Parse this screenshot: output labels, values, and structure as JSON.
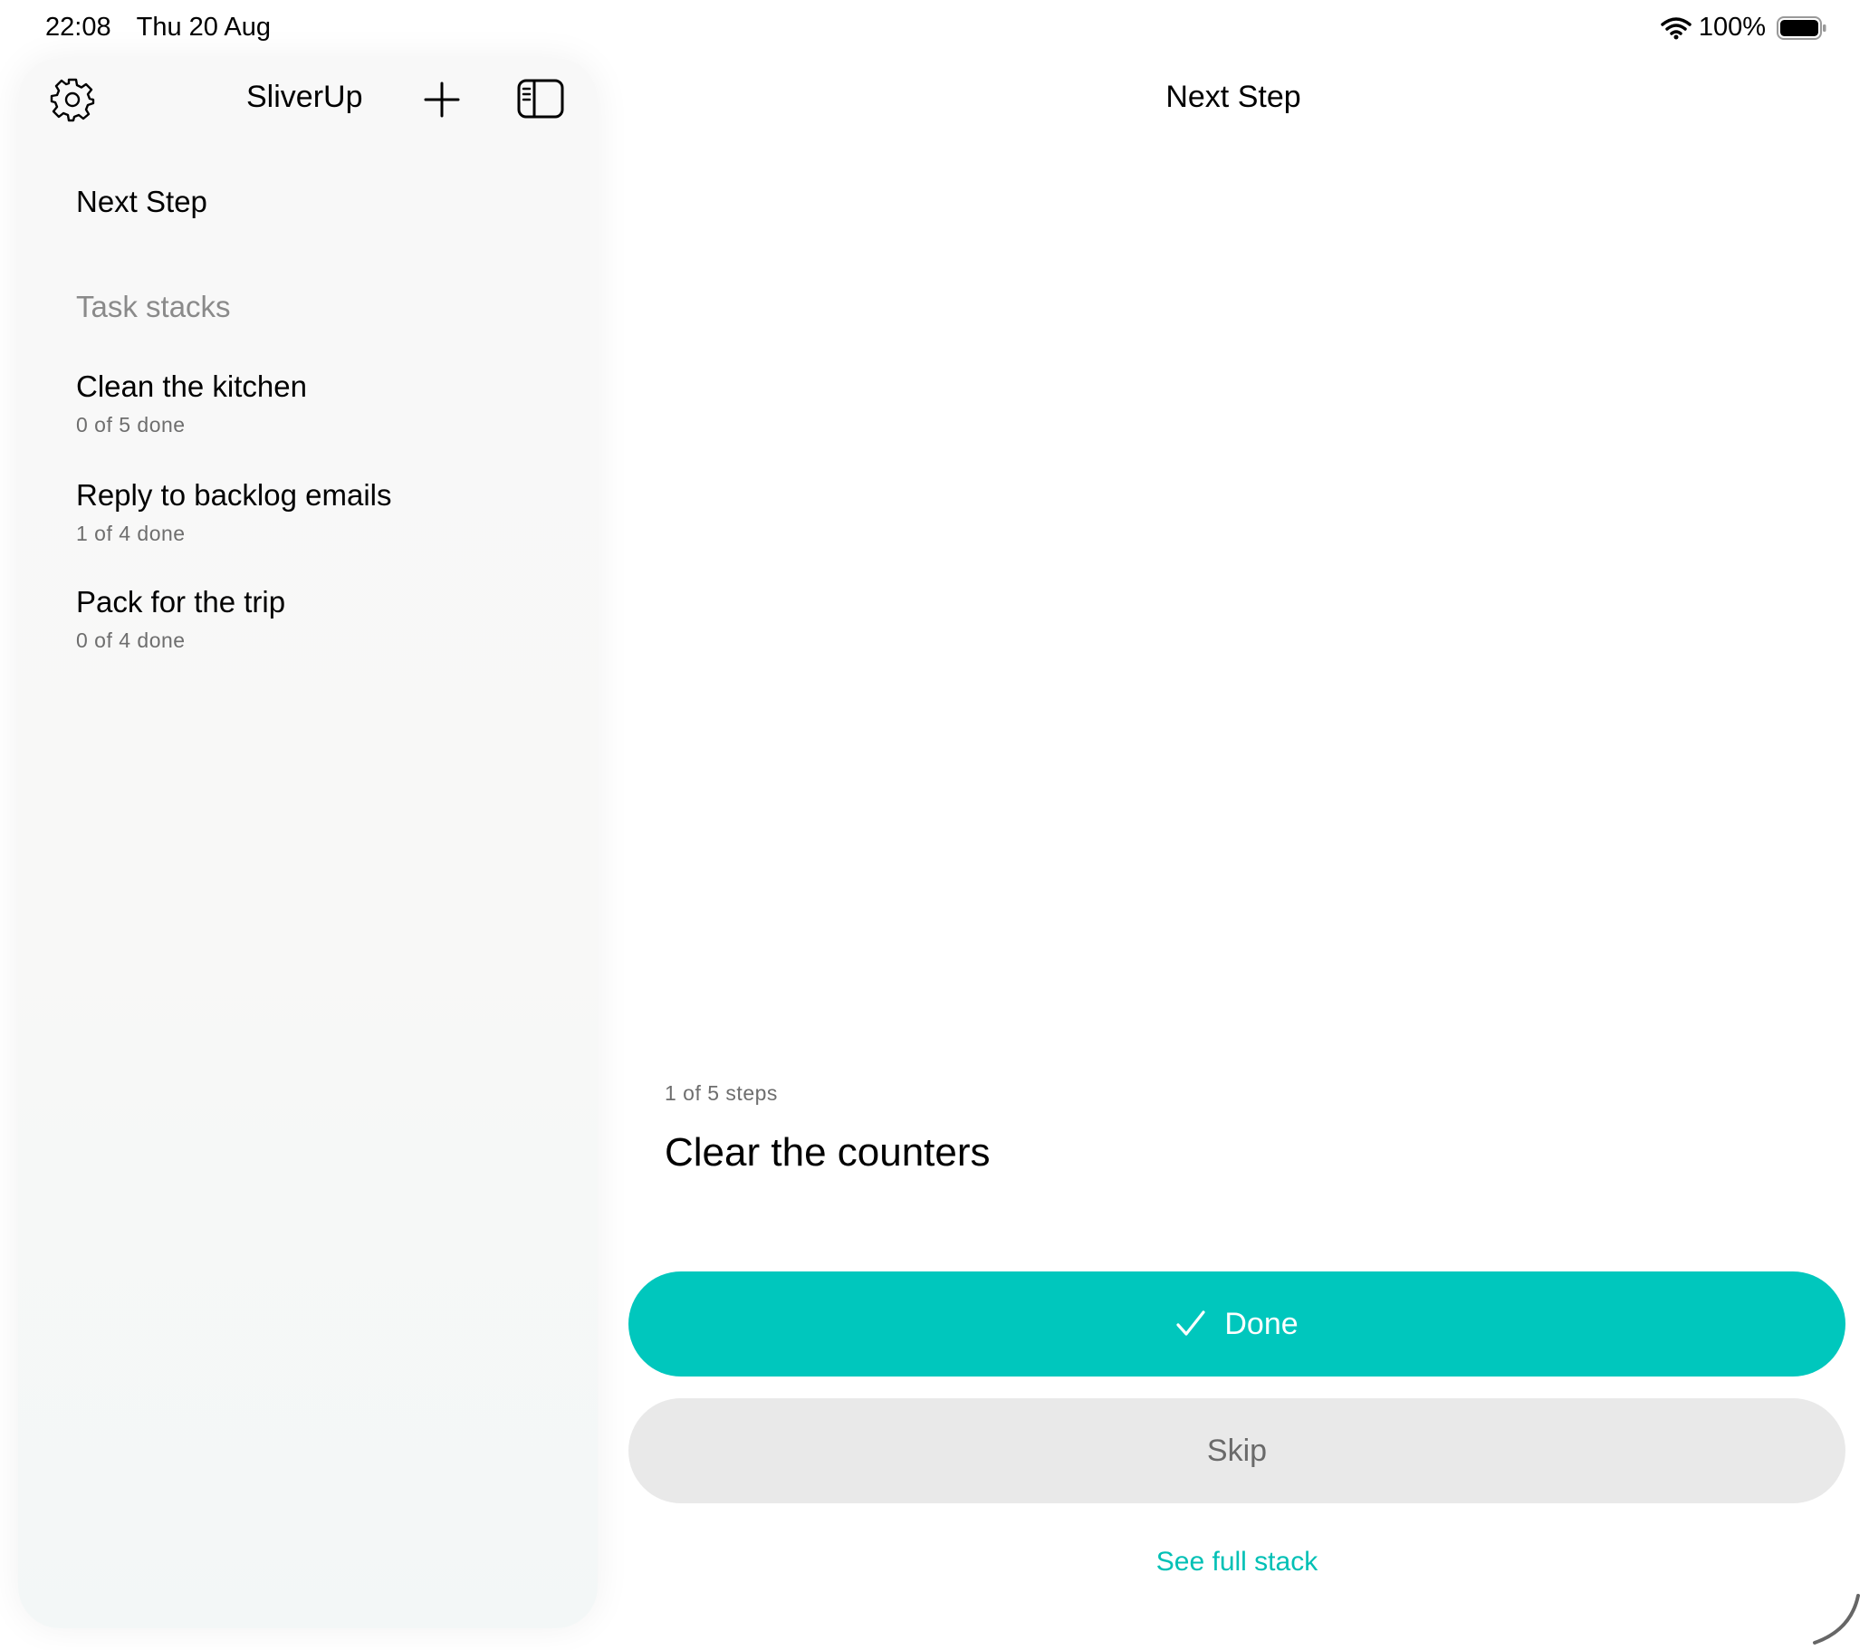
{
  "status_bar": {
    "time": "22:08",
    "date": "Thu 20 Aug",
    "battery": "100%"
  },
  "sidebar": {
    "app_name": "SliverUp",
    "nav_next_step": "Next Step",
    "section_label": "Task stacks",
    "stacks": [
      {
        "title": "Clean the kitchen",
        "progress": "0 of 5 done"
      },
      {
        "title": "Reply to backlog emails",
        "progress": "1 of 4 done"
      },
      {
        "title": "Pack for the trip",
        "progress": "0 of 4 done"
      }
    ]
  },
  "main": {
    "title": "Next Step",
    "step_progress": "1 of 5 steps",
    "step_title": "Clear the counters",
    "done_label": "Done",
    "skip_label": "Skip",
    "see_full_stack_label": "See full stack"
  },
  "colors": {
    "accent": "#00c7bd",
    "link": "#00c0b5",
    "skip_bg": "#e9e9e9"
  },
  "icons": [
    "wifi-icon",
    "battery-icon",
    "gear-icon",
    "plus-icon",
    "sidebar-toggle-icon",
    "checkmark-icon"
  ]
}
